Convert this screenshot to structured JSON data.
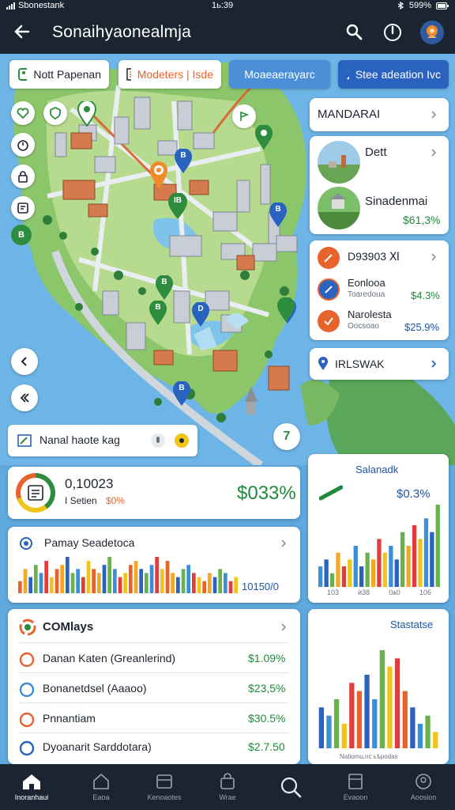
{
  "status_bar": {
    "carrier": "Sbonestank",
    "time": "1ь:39",
    "battery": "599%"
  },
  "app_bar": {
    "title": "Sonaihyaonealmja"
  },
  "chips": [
    {
      "label": "Nott Papenan"
    },
    {
      "label": "Modeters | Isde"
    },
    {
      "label": "Moaeaerayarc"
    },
    {
      "label": "Stee adeation Ivc"
    }
  ],
  "map": {
    "pins": [
      "B",
      "B",
      "IB",
      "B",
      "B",
      "B",
      "D",
      "B",
      "B"
    ],
    "zoom_badge": "7"
  },
  "search": {
    "placeholder": "Nanal haote kag"
  },
  "right_panel": {
    "header": {
      "label": "MANDARAI"
    },
    "places": [
      {
        "title": "Dett",
        "value": ""
      },
      {
        "title": "Sinadenmai",
        "value": "$61,3%"
      }
    ],
    "items": [
      {
        "title": "D93903 Ⅺ",
        "subtitle": "",
        "value": ""
      },
      {
        "title": "Eonlooa",
        "subtitle": "Toaredoua",
        "value": "$4.3%"
      },
      {
        "title": "Narolesta",
        "subtitle": "Oocsoao",
        "value": "$25.9%"
      }
    ],
    "location": {
      "label": "IRLSWAK"
    }
  },
  "summary_card": {
    "number": "0,10023",
    "label": "I Setien",
    "percent": "$0%",
    "value": "$033%"
  },
  "trend_card": {
    "title": "Salanadk",
    "value": "$0.3%"
  },
  "chart_card": {
    "title": "Pamay Seadetoca",
    "value": "10150/0"
  },
  "chart_data": [
    {
      "type": "bar",
      "title": "Pamay Seadetoca",
      "values": [
        3,
        6,
        4,
        7,
        5,
        8,
        4,
        6,
        7,
        9,
        5,
        6,
        4,
        8,
        6,
        5,
        7,
        9,
        6,
        4,
        5,
        7,
        8,
        6,
        5,
        7,
        9,
        6,
        8,
        5,
        4,
        6,
        7,
        5,
        4,
        3,
        5,
        4,
        6,
        5,
        3,
        4
      ],
      "colors": [
        "#e8632b",
        "#f5a623",
        "#2a62c0",
        "#6ab04c",
        "#3b8fd8",
        "#e23d3d",
        "#f0c419"
      ]
    },
    {
      "type": "bar",
      "title": "Salanadk",
      "categories": [
        "103",
        "ѝ38",
        "0ѧ0",
        "106"
      ],
      "values": [
        3,
        4,
        2,
        5,
        3,
        4,
        6,
        3,
        5,
        4,
        7,
        5,
        6,
        4,
        8,
        6,
        9,
        7,
        10,
        8,
        12
      ],
      "colors": [
        "#3b8fd8",
        "#2a62c0",
        "#6ab04c",
        "#f5a623",
        "#e23d3d",
        "#f0c419"
      ]
    },
    {
      "type": "bar",
      "title": "Stastatse",
      "values": [
        5,
        4,
        6,
        3,
        8,
        7,
        9,
        6,
        12,
        10,
        11,
        7,
        5,
        3,
        4,
        2
      ],
      "colors": [
        "#2a62c0",
        "#3b8fd8",
        "#6ab04c",
        "#f0c419",
        "#e23d3d",
        "#e8632b"
      ]
    }
  ],
  "list_card": {
    "title": "COMlays",
    "rows": [
      {
        "label": "Danan Katen (Greanlerind)",
        "value": "$1.09%",
        "icon_color": "#e8632b"
      },
      {
        "label": "Bonanetdsel (Aaaoo)",
        "value": "$23,5%",
        "icon_color": "#3b8fd8"
      },
      {
        "label": "Pnnantiam",
        "value": "$30.5%",
        "icon_color": "#e8632b"
      },
      {
        "label": "Dyoanarit Sarddotara)",
        "value": "$2.7.50",
        "icon_color": "#2a62c0"
      }
    ]
  },
  "stats_card": {
    "title": "Stastatse",
    "caption": "Nаtiomu,nc ьѣpodas"
  },
  "bottom_nav": [
    {
      "label": "Inoranhaui",
      "icon": "home-icon"
    },
    {
      "label": "Eaoa",
      "icon": "house-outline-icon"
    },
    {
      "label": "Kenoaotes",
      "icon": "card-icon"
    },
    {
      "label": "Wrae",
      "icon": "bag-icon"
    },
    {
      "label": "",
      "icon": "search-icon"
    },
    {
      "label": "Evaoon",
      "icon": "tablet-icon"
    },
    {
      "label": "Aoosion",
      "icon": "profile-icon"
    }
  ],
  "colors": {
    "bar_dark": "#1b2431",
    "green": "#1f8a3a",
    "accent_blue": "#2a62c0"
  }
}
